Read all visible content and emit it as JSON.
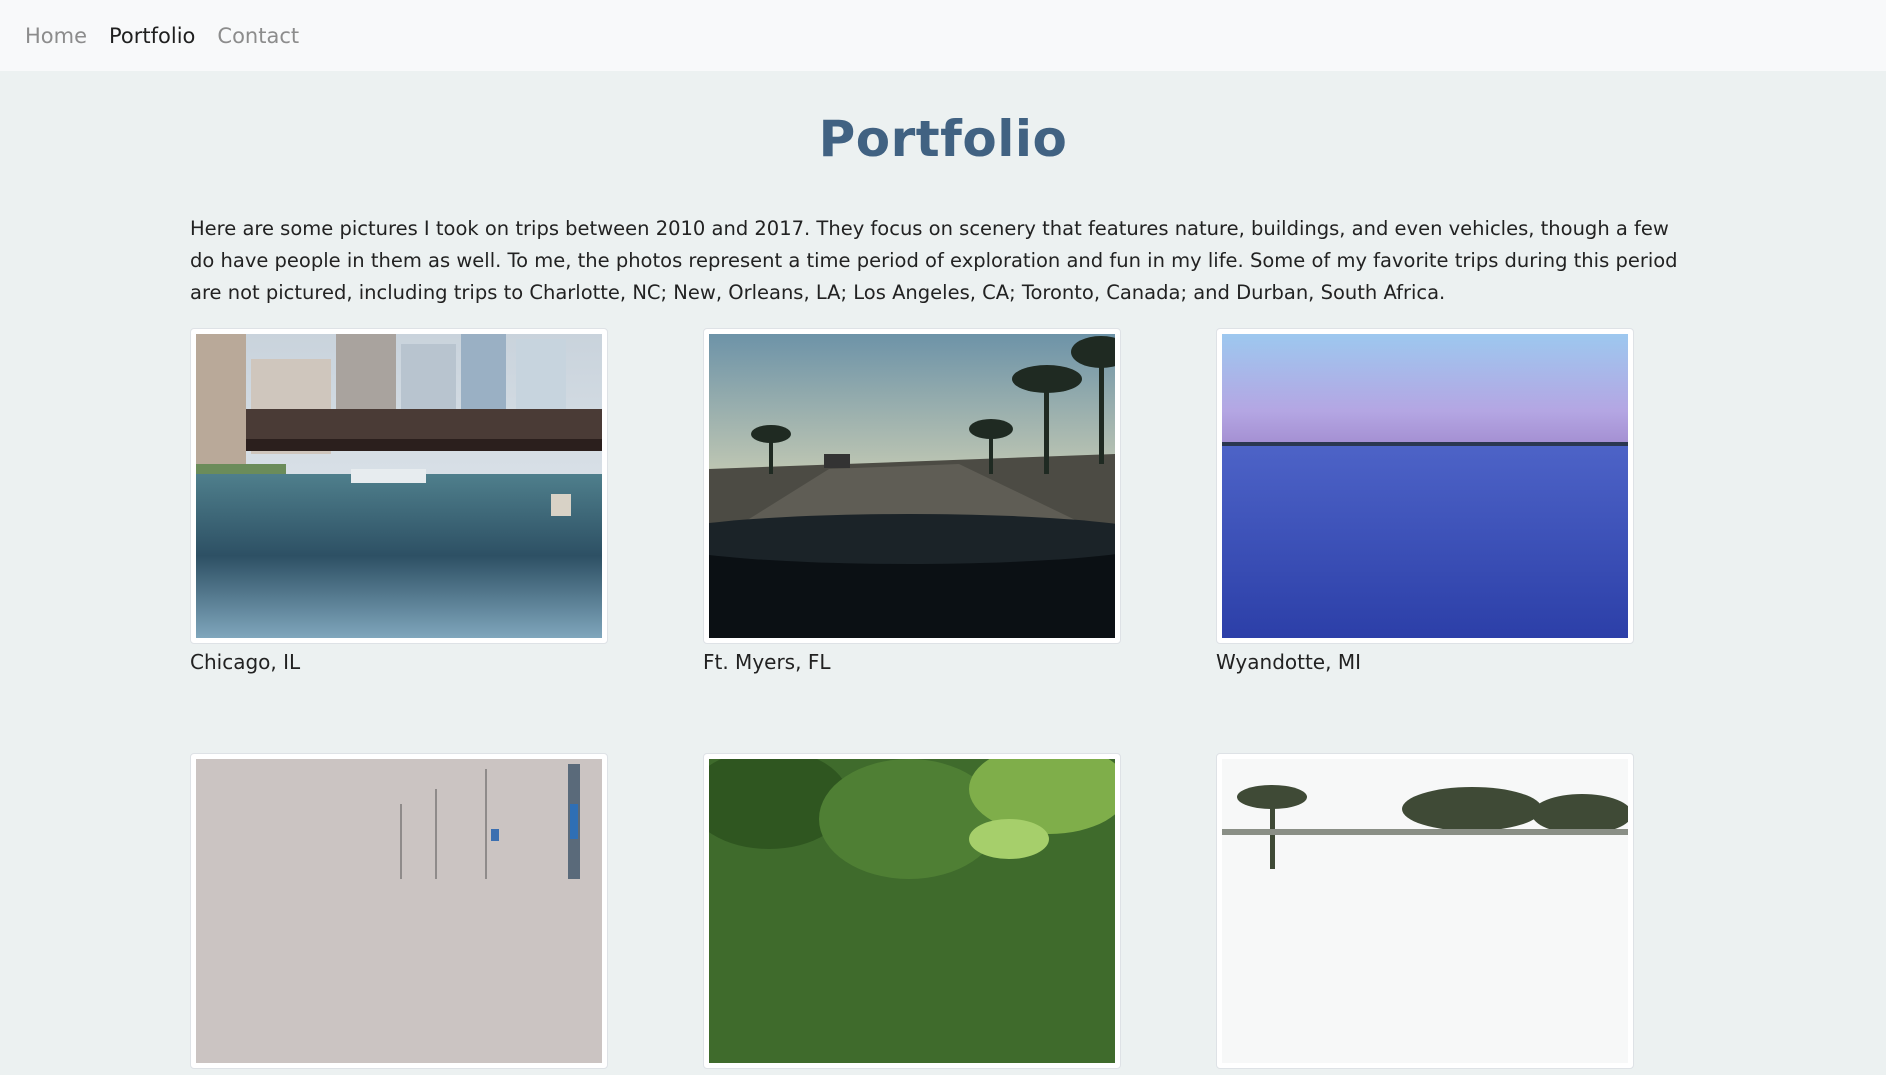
{
  "nav": {
    "items": [
      {
        "label": "Home",
        "active": false
      },
      {
        "label": "Portfolio",
        "active": true
      },
      {
        "label": "Contact",
        "active": false
      }
    ]
  },
  "page": {
    "title": "Portfolio",
    "intro": "Here are some pictures I took on trips between 2010 and 2017. They focus on scenery that features nature, buildings, and even vehicles, though a few do have people in them as well. To me, the photos represent a time period of exploration and fun in my life. Some of my favorite trips during this period are not pictured, including trips to Charlotte, NC; New, Orleans, LA; Los Angeles, CA; Toronto, Canada; and Durban, South Africa."
  },
  "gallery": {
    "items": [
      {
        "caption": "Chicago, IL"
      },
      {
        "caption": "Ft. Myers, FL"
      },
      {
        "caption": "Wyandotte, MI"
      },
      {
        "caption": ""
      },
      {
        "caption": ""
      },
      {
        "caption": ""
      }
    ]
  },
  "colors": {
    "title": "#416282",
    "background": "#ecf1f1",
    "navbar": "#f8f9fa"
  }
}
